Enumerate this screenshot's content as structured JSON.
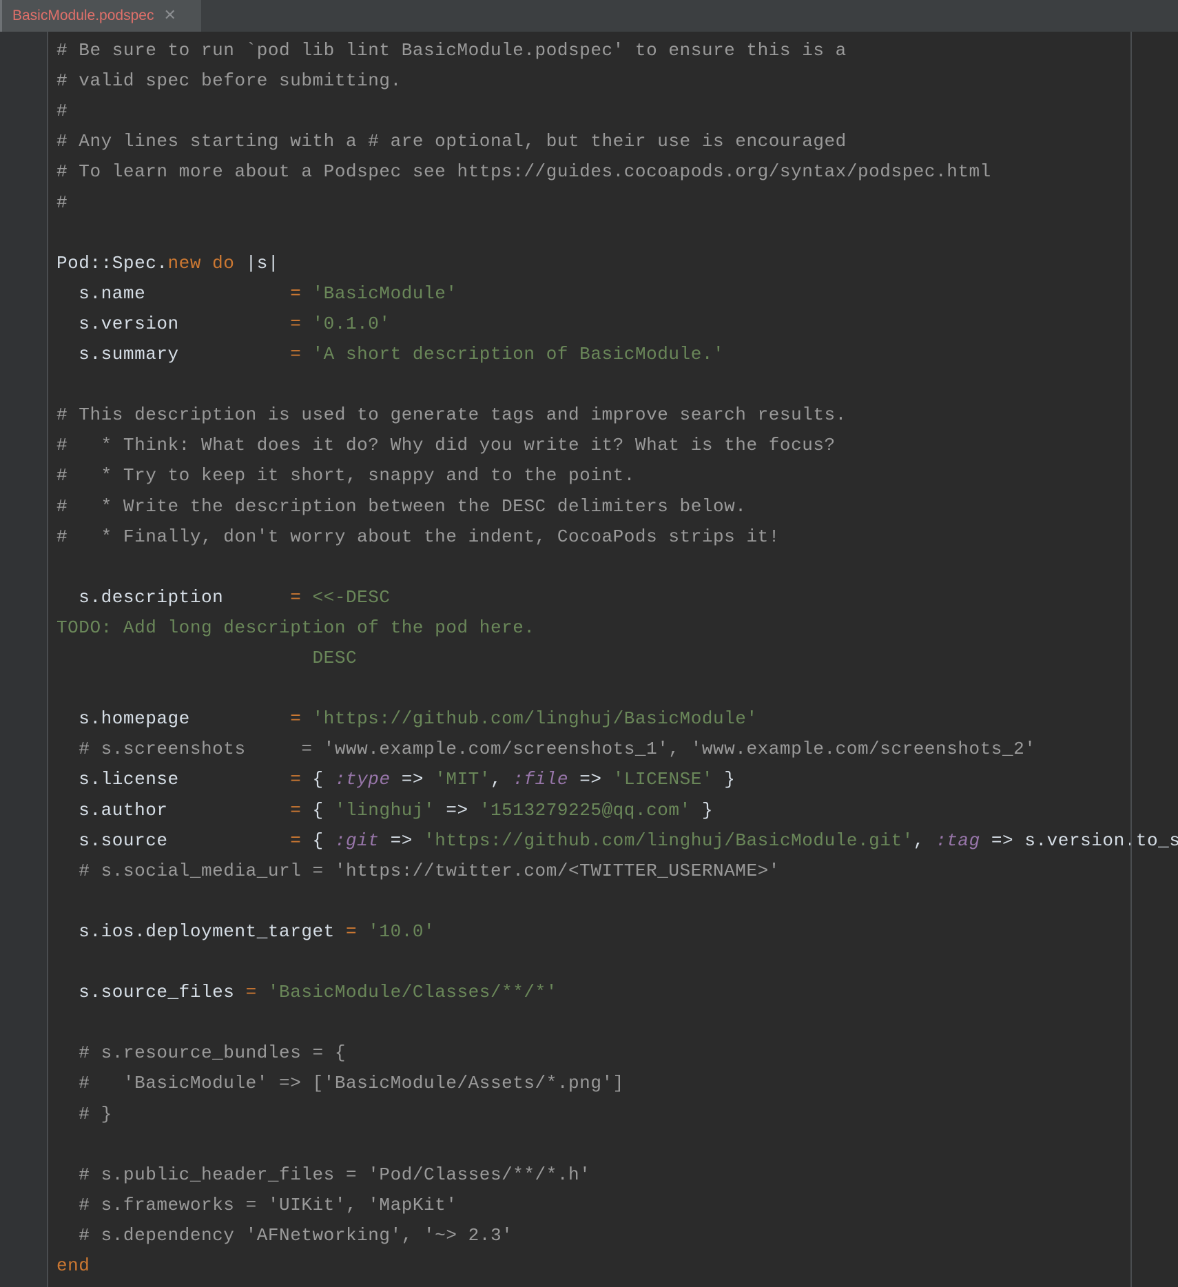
{
  "tab": {
    "filename": "BasicModule.podspec",
    "close_glyph": "✕",
    "active_color": "#e0706a"
  },
  "theme": {
    "background": "#2b2b2b",
    "comment": "#9a9a9a",
    "keyword": "#cc7832",
    "string": "#6a8759",
    "symbol": "#9876aa",
    "plain": "#d6dee6"
  },
  "code": {
    "lines": [
      {
        "tokens": [
          {
            "t": "c",
            "v": "# Be sure to run `pod lib lint BasicModule.podspec' to ensure this is a"
          }
        ]
      },
      {
        "tokens": [
          {
            "t": "c",
            "v": "# valid spec before submitting."
          }
        ]
      },
      {
        "tokens": [
          {
            "t": "c",
            "v": "#"
          }
        ]
      },
      {
        "tokens": [
          {
            "t": "c",
            "v": "# Any lines starting with a # are optional, but their use is encouraged"
          }
        ]
      },
      {
        "tokens": [
          {
            "t": "c",
            "v": "# To learn more about a Podspec see https://guides.cocoapods.org/syntax/podspec.html"
          }
        ]
      },
      {
        "tokens": [
          {
            "t": "c",
            "v": "#"
          }
        ]
      },
      {
        "tokens": []
      },
      {
        "tokens": [
          {
            "t": "p",
            "v": "Pod::Spec."
          },
          {
            "t": "k",
            "v": "new"
          },
          {
            "t": "p",
            "v": " "
          },
          {
            "t": "k",
            "v": "do"
          },
          {
            "t": "p",
            "v": " |s|"
          }
        ]
      },
      {
        "tokens": [
          {
            "t": "p",
            "v": "  s.name             "
          },
          {
            "t": "o",
            "v": "="
          },
          {
            "t": "p",
            "v": " "
          },
          {
            "t": "s",
            "v": "'BasicModule'"
          }
        ]
      },
      {
        "tokens": [
          {
            "t": "p",
            "v": "  s.version          "
          },
          {
            "t": "o",
            "v": "="
          },
          {
            "t": "p",
            "v": " "
          },
          {
            "t": "s",
            "v": "'0.1.0'"
          }
        ]
      },
      {
        "tokens": [
          {
            "t": "p",
            "v": "  s.summary          "
          },
          {
            "t": "o",
            "v": "="
          },
          {
            "t": "p",
            "v": " "
          },
          {
            "t": "s",
            "v": "'A short description of BasicModule.'"
          }
        ]
      },
      {
        "tokens": []
      },
      {
        "tokens": [
          {
            "t": "c",
            "v": "# This description is used to generate tags and improve search results."
          }
        ]
      },
      {
        "tokens": [
          {
            "t": "c",
            "v": "#   * Think: What does it do? Why did you write it? What is the focus?"
          }
        ]
      },
      {
        "tokens": [
          {
            "t": "c",
            "v": "#   * Try to keep it short, snappy and to the point."
          }
        ]
      },
      {
        "tokens": [
          {
            "t": "c",
            "v": "#   * Write the description between the DESC delimiters below."
          }
        ]
      },
      {
        "tokens": [
          {
            "t": "c",
            "v": "#   * Finally, don't worry about the indent, CocoaPods strips it!"
          }
        ]
      },
      {
        "tokens": []
      },
      {
        "tokens": [
          {
            "t": "p",
            "v": "  s.description      "
          },
          {
            "t": "o",
            "v": "="
          },
          {
            "t": "p",
            "v": " "
          },
          {
            "t": "h",
            "v": "<<-DESC"
          }
        ]
      },
      {
        "tokens": [
          {
            "t": "h",
            "v": "TODO: Add long description of the pod here."
          }
        ]
      },
      {
        "tokens": [
          {
            "t": "h",
            "v": "                       DESC"
          }
        ]
      },
      {
        "tokens": []
      },
      {
        "tokens": [
          {
            "t": "p",
            "v": "  s.homepage         "
          },
          {
            "t": "o",
            "v": "="
          },
          {
            "t": "p",
            "v": " "
          },
          {
            "t": "s",
            "v": "'https://github.com/linghuj/BasicModule'"
          }
        ]
      },
      {
        "tokens": [
          {
            "t": "c",
            "v": "  # s.screenshots     = 'www.example.com/screenshots_1', 'www.example.com/screenshots_2'"
          }
        ]
      },
      {
        "tokens": [
          {
            "t": "p",
            "v": "  s.license          "
          },
          {
            "t": "o",
            "v": "="
          },
          {
            "t": "p",
            "v": " { "
          },
          {
            "t": "y",
            "v": ":type"
          },
          {
            "t": "p",
            "v": " => "
          },
          {
            "t": "s",
            "v": "'MIT'"
          },
          {
            "t": "p",
            "v": ", "
          },
          {
            "t": "y",
            "v": ":file"
          },
          {
            "t": "p",
            "v": " => "
          },
          {
            "t": "s",
            "v": "'LICENSE'"
          },
          {
            "t": "p",
            "v": " }"
          }
        ]
      },
      {
        "tokens": [
          {
            "t": "p",
            "v": "  s.author           "
          },
          {
            "t": "o",
            "v": "="
          },
          {
            "t": "p",
            "v": " { "
          },
          {
            "t": "s",
            "v": "'linghuj'"
          },
          {
            "t": "p",
            "v": " => "
          },
          {
            "t": "s",
            "v": "'1513279225@qq.com'"
          },
          {
            "t": "p",
            "v": " }"
          }
        ]
      },
      {
        "tokens": [
          {
            "t": "p",
            "v": "  s.source           "
          },
          {
            "t": "o",
            "v": "="
          },
          {
            "t": "p",
            "v": " { "
          },
          {
            "t": "y",
            "v": ":git"
          },
          {
            "t": "p",
            "v": " => "
          },
          {
            "t": "s",
            "v": "'https://github.com/linghuj/BasicModule.git'"
          },
          {
            "t": "p",
            "v": ", "
          },
          {
            "t": "y",
            "v": ":tag"
          },
          {
            "t": "p",
            "v": " => s.version.to_s }"
          }
        ]
      },
      {
        "tokens": [
          {
            "t": "c",
            "v": "  # s.social_media_url = 'https://twitter.com/<TWITTER_USERNAME>'"
          }
        ]
      },
      {
        "tokens": []
      },
      {
        "tokens": [
          {
            "t": "p",
            "v": "  s.ios.deployment_target "
          },
          {
            "t": "o",
            "v": "="
          },
          {
            "t": "p",
            "v": " "
          },
          {
            "t": "s",
            "v": "'10.0'"
          }
        ]
      },
      {
        "tokens": []
      },
      {
        "tokens": [
          {
            "t": "p",
            "v": "  s.source_files "
          },
          {
            "t": "o",
            "v": "="
          },
          {
            "t": "p",
            "v": " "
          },
          {
            "t": "s",
            "v": "'BasicModule/Classes/**/*'"
          }
        ]
      },
      {
        "tokens": []
      },
      {
        "tokens": [
          {
            "t": "c",
            "v": "  # s.resource_bundles = {"
          }
        ]
      },
      {
        "tokens": [
          {
            "t": "c",
            "v": "  #   'BasicModule' => ['BasicModule/Assets/*.png']"
          }
        ]
      },
      {
        "tokens": [
          {
            "t": "c",
            "v": "  # }"
          }
        ]
      },
      {
        "tokens": []
      },
      {
        "tokens": [
          {
            "t": "c",
            "v": "  # s.public_header_files = 'Pod/Classes/**/*.h'"
          }
        ]
      },
      {
        "tokens": [
          {
            "t": "c",
            "v": "  # s.frameworks = 'UIKit', 'MapKit'"
          }
        ]
      },
      {
        "tokens": [
          {
            "t": "c",
            "v": "  # s.dependency 'AFNetworking', '~> 2.3'"
          }
        ]
      },
      {
        "tokens": [
          {
            "t": "k",
            "v": "end"
          }
        ]
      }
    ]
  }
}
